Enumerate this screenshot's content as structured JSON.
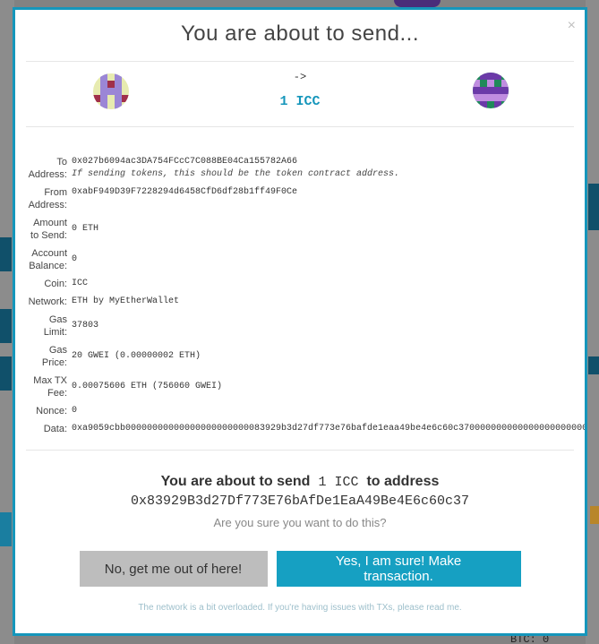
{
  "modal": {
    "title": "You are about to send...",
    "close_label": "×",
    "arrow": "->",
    "amount": "1 ICC"
  },
  "details": {
    "to_label_line1": "To",
    "to_label_line2": "Address:",
    "to_value": "0x027b6094ac3DA754FCcC7C088BE04Ca155782A66",
    "to_hint": "If sending tokens, this should be the token contract address.",
    "from_label_line1": "From",
    "from_label_line2": "Address:",
    "from_value": "0xabF949D39F7228294d6458CfD6df28b1ff49F0Ce",
    "amount_label_line1": "Amount",
    "amount_label_line2": "to Send:",
    "amount_value": "0 ETH",
    "balance_label_line1": "Account",
    "balance_label_line2": "Balance:",
    "balance_value": "0",
    "coin_label": "Coin:",
    "coin_value": "ICC",
    "network_label": "Network:",
    "network_value": "ETH by MyEtherWallet",
    "gaslimit_label_line1": "Gas",
    "gaslimit_label_line2": "Limit:",
    "gaslimit_value": "37803",
    "gasprice_label_line1": "Gas",
    "gasprice_label_line2": "Price:",
    "gasprice_value": "20 GWEI (0.00000002 ETH)",
    "maxfee_label_line1": "Max TX",
    "maxfee_label_line2": "Fee:",
    "maxfee_value": "0.00075606 ETH (756060 GWEI)",
    "nonce_label": "Nonce:",
    "nonce_value": "0",
    "data_label": "Data:",
    "data_value": "0xa9059cbb00000000000000000000000083929b3d27df773e76bafde1eaa49be4e6c60c37000000000000000000000000"
  },
  "confirm": {
    "line_prefix": "You are about to send",
    "line_amount": " 1 ICC ",
    "line_suffix": "to address",
    "address": "0x83929B3d27Df773E76bAfDe1EaA49Be4E6c60c37",
    "question": "Are you sure you want to do this?",
    "no_button": "No, get me out of here!",
    "yes_button": "Yes, I am sure! Make transaction.",
    "footer_note": "The network is a bit overloaded. If you're having issues with TXs, please read me."
  },
  "background": {
    "bottom_text": "BTC: 0"
  },
  "colors": {
    "accent": "#1596bb",
    "button_yes": "#16a0c2",
    "button_no": "#bdbdbd"
  },
  "icons": {
    "from_identicon": "identicon-from",
    "to_identicon": "identicon-to",
    "close": "close-icon"
  }
}
